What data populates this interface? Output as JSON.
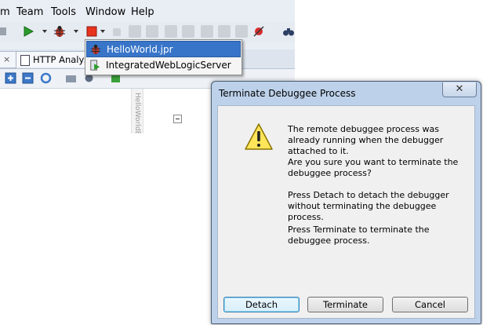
{
  "menubar": {
    "items": [
      "m",
      "Team",
      "Tools",
      "Window",
      "Help"
    ]
  },
  "tabs": {
    "close_glyph": "×",
    "http_tab_label": "HTTP Analyze"
  },
  "run_dropdown": {
    "items": [
      {
        "label": "HelloWorld.jpr",
        "icon": "debug-bug-icon",
        "selected": true
      },
      {
        "label": "IntegratedWebLogicServer",
        "icon": "server-run-icon",
        "selected": false
      }
    ]
  },
  "editor": {
    "vertical_label": "HelloWorldB"
  },
  "dialog": {
    "title": "Terminate Debuggee Process",
    "close_glyph": "✕",
    "icon": "warning-icon",
    "messages": [
      "The remote debuggee process was already running when the debugger attached to it.",
      "Are you sure you want to terminate the debuggee process?",
      "Press Detach to detach the debugger without terminating the debuggee process.",
      "Press Terminate to terminate the debuggee process."
    ],
    "buttons": {
      "detach": "Detach",
      "terminate": "Terminate",
      "cancel": "Cancel"
    }
  },
  "colors": {
    "accent_selection": "#3875c8",
    "dialog_frame": "#bdd1ea",
    "warning_fill": "#ffe55a"
  }
}
